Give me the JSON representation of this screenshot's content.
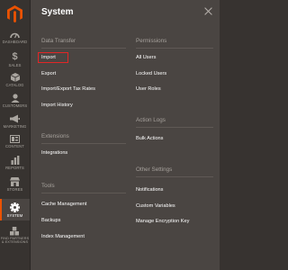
{
  "sidebar": {
    "items": [
      {
        "label": "Dashboard"
      },
      {
        "label": "Sales",
        "glyph": "$"
      },
      {
        "label": "Catalog"
      },
      {
        "label": "Customers"
      },
      {
        "label": "Marketing"
      },
      {
        "label": "Content"
      },
      {
        "label": "Reports"
      },
      {
        "label": "Stores"
      },
      {
        "label": "System"
      },
      {
        "label": "Find Partners & Extensions"
      }
    ],
    "active": "System"
  },
  "panel": {
    "title": "System",
    "left_column": [
      {
        "heading": "Data Transfer",
        "links": [
          "Import",
          "Export",
          "Import/Export Tax Rates",
          "Import History"
        ]
      },
      {
        "heading": "Extensions",
        "links": [
          "Integrations"
        ]
      },
      {
        "heading": "Tools",
        "links": [
          "Cache Management",
          "Backups",
          "Index Management"
        ]
      }
    ],
    "right_column": [
      {
        "heading": "Permissions",
        "links": [
          "All Users",
          "Locked Users",
          "User Roles"
        ]
      },
      {
        "heading": "Action Logs",
        "links": [
          "Bulk Actions"
        ]
      },
      {
        "heading": "Other Settings",
        "links": [
          "Notifications",
          "Custom Variables",
          "Manage Encryption Key"
        ]
      }
    ]
  },
  "colors": {
    "accent": "#eb5202",
    "highlight_box": "#e22626",
    "panel_bg": "#4a4542",
    "sidebar_bg": "#373330"
  }
}
